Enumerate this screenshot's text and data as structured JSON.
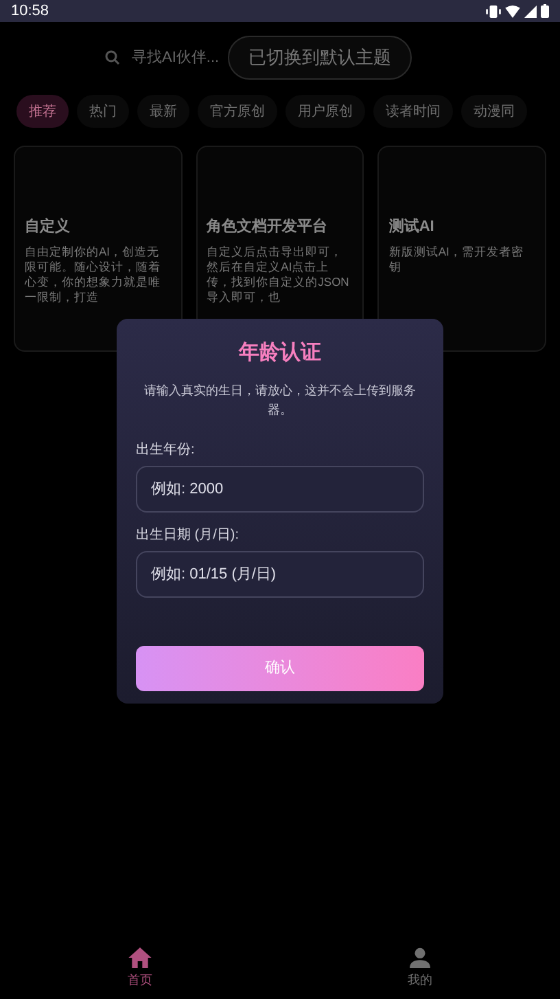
{
  "status_bar": {
    "time": "10:58"
  },
  "search": {
    "placeholder": "寻找AI伙伴..."
  },
  "toast": {
    "text": "已切换到默认主题"
  },
  "tabs": [
    {
      "label": "推荐",
      "selected": true
    },
    {
      "label": "热门",
      "selected": false
    },
    {
      "label": "最新",
      "selected": false
    },
    {
      "label": "官方原创",
      "selected": false
    },
    {
      "label": "用户原创",
      "selected": false
    },
    {
      "label": "读者时间",
      "selected": false
    },
    {
      "label": "动漫同",
      "selected": false
    }
  ],
  "cards": [
    {
      "title": "自定义",
      "description": "自由定制你的AI，创造无限可能。随心设计，随着心变，你的想象力就是唯一限制，打造"
    },
    {
      "title": "角色文档开发平台",
      "description": "自定义后点击导出即可，然后在自定义AI点击上传，找到你自定义的JSON导入即可，也"
    },
    {
      "title": "测试AI",
      "description": "新版测试AI，需开发者密钥"
    }
  ],
  "dialog": {
    "title": "年龄认证",
    "message": "请输入真实的生日，请放心，这并不会上传到服务器。",
    "fields": [
      {
        "label": "出生年份:",
        "placeholder": "例如: 2000"
      },
      {
        "label": "出生日期 (月/日):",
        "placeholder": "例如: 01/15 (月/日)"
      }
    ],
    "button": "确认"
  },
  "bottom_nav": [
    {
      "label": "首页",
      "kind": "home",
      "selected": true
    },
    {
      "label": "我的",
      "kind": "profile",
      "selected": false
    }
  ]
}
